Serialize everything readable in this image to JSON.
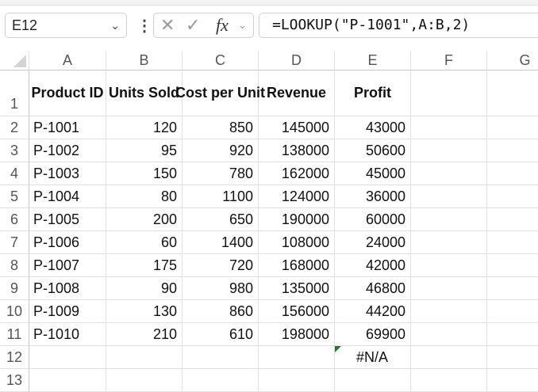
{
  "name_box": "E12",
  "formula": "=LOOKUP(\"P-1001\",A:B,2)",
  "fx_label": "fx",
  "columns": [
    "A",
    "B",
    "C",
    "D",
    "E",
    "F",
    "G"
  ],
  "rows": [
    "1",
    "2",
    "3",
    "4",
    "5",
    "6",
    "7",
    "8",
    "9",
    "10",
    "11",
    "12",
    "13"
  ],
  "headers": [
    "Product ID",
    "Units Sold",
    "Cost per Unit",
    "Revenue",
    "Profit"
  ],
  "data": [
    [
      "P-1001",
      "120",
      "850",
      "145000",
      "43000"
    ],
    [
      "P-1002",
      "95",
      "920",
      "138000",
      "50600"
    ],
    [
      "P-1003",
      "150",
      "780",
      "162000",
      "45000"
    ],
    [
      "P-1004",
      "80",
      "1100",
      "124000",
      "36000"
    ],
    [
      "P-1005",
      "200",
      "650",
      "190000",
      "60000"
    ],
    [
      "P-1006",
      "60",
      "1400",
      "108000",
      "24000"
    ],
    [
      "P-1007",
      "175",
      "720",
      "168000",
      "42000"
    ],
    [
      "P-1008",
      "90",
      "980",
      "135000",
      "46800"
    ],
    [
      "P-1009",
      "130",
      "860",
      "156000",
      "44200"
    ],
    [
      "P-1010",
      "210",
      "610",
      "198000",
      "69900"
    ]
  ],
  "e12_value": "#N/A"
}
